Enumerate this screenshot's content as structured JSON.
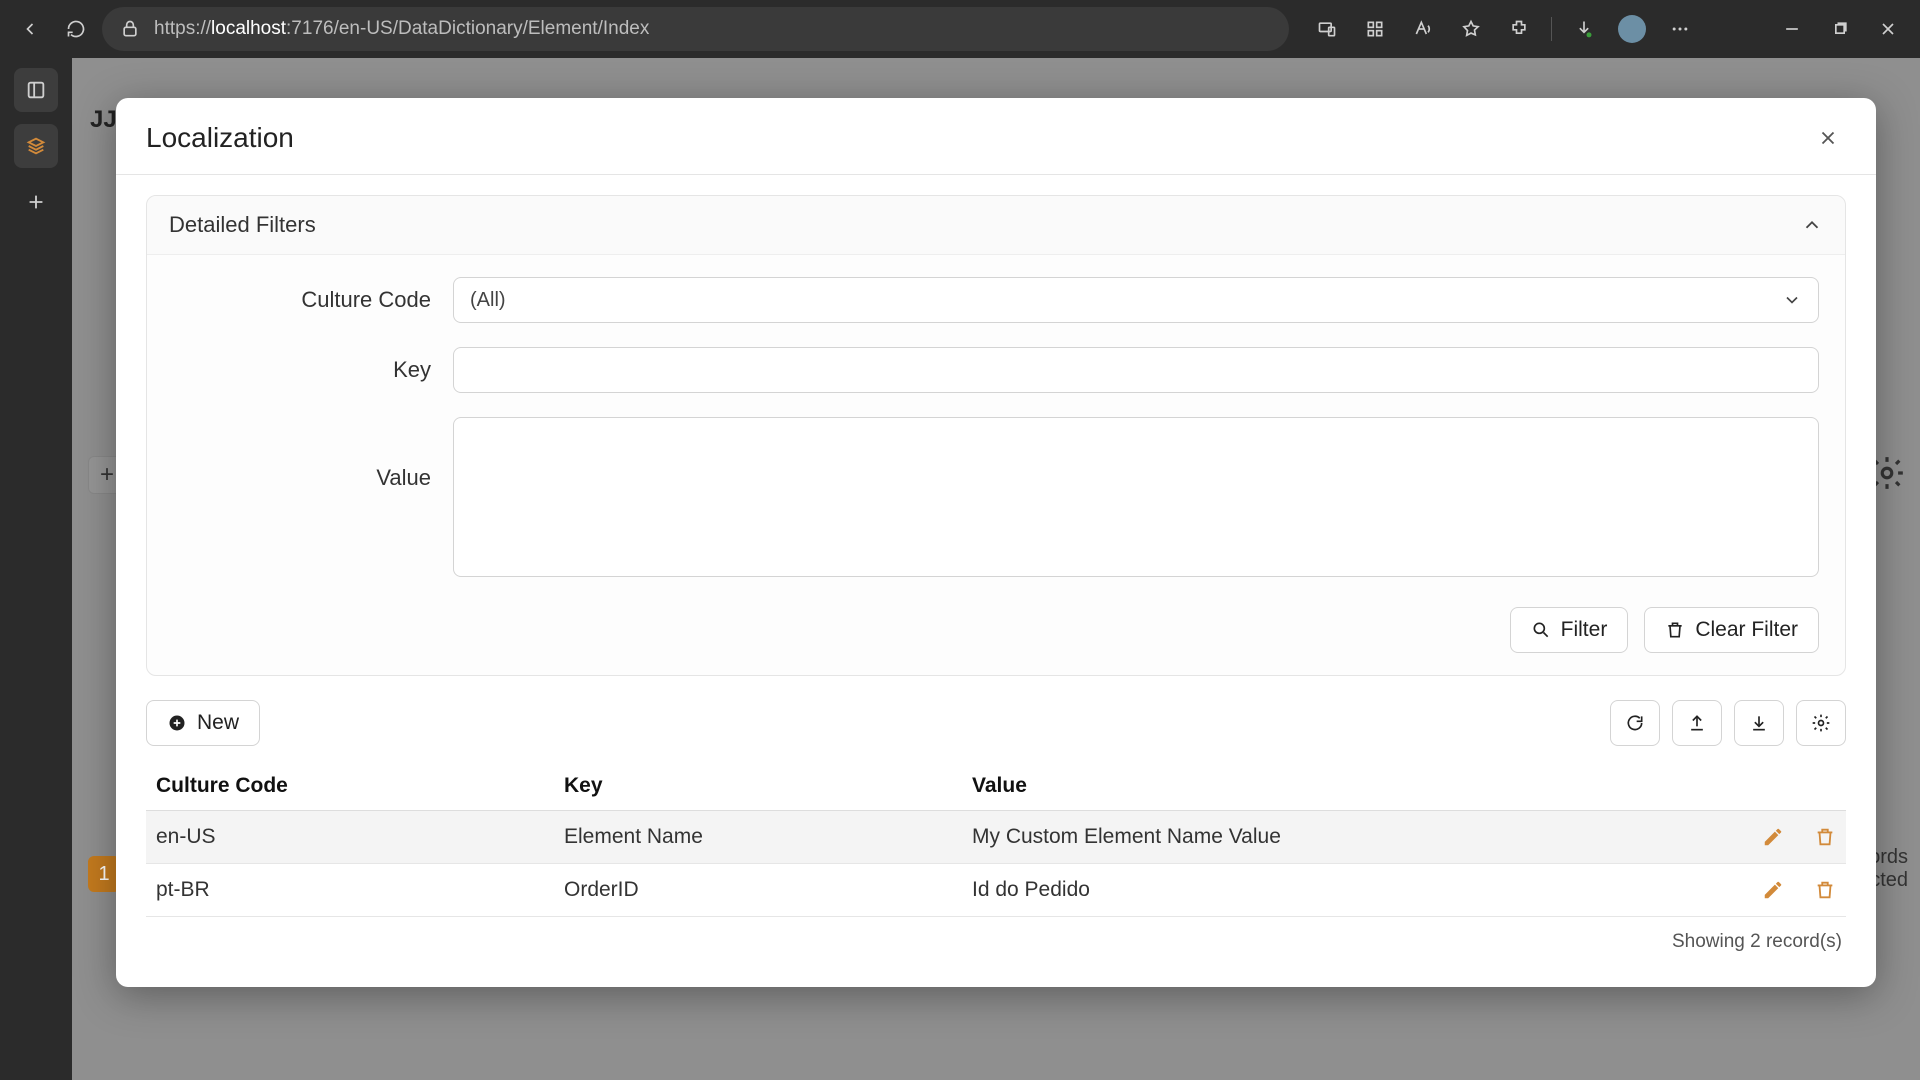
{
  "browser": {
    "url_prefix": "https://",
    "url_host": "localhost",
    "url_suffix": ":7176/en-US/DataDictionary/Element/Index"
  },
  "backdrop": {
    "logo_fragment": "JJM",
    "add": "+",
    "page_num": "1",
    "right_text_1": "ords",
    "right_text_2": "cted"
  },
  "modal": {
    "title": "Localization",
    "filters_title": "Detailed Filters",
    "labels": {
      "culture_code": "Culture Code",
      "key": "Key",
      "value": "Value"
    },
    "select_all": "(All)",
    "filter_btn": "Filter",
    "clear_btn": "Clear Filter",
    "new_btn": "New",
    "columns": {
      "culture": "Culture Code",
      "key": "Key",
      "value": "Value"
    },
    "rows": [
      {
        "culture": "en-US",
        "key": "Element Name",
        "value": "My Custom Element Name Value"
      },
      {
        "culture": "pt-BR",
        "key": "OrderID",
        "value": "Id do Pedido"
      }
    ],
    "footer": "Showing 2 record(s)"
  }
}
